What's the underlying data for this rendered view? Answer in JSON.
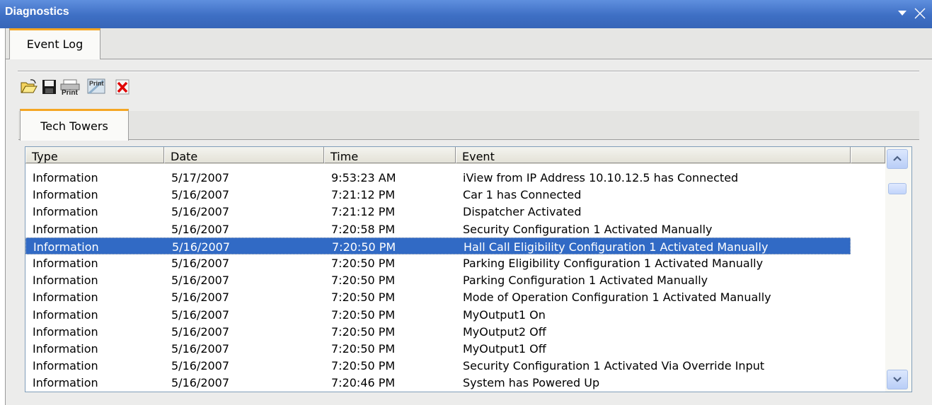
{
  "window": {
    "title": "Diagnostics",
    "dropdown_icon": "chevron-down-icon",
    "close_icon": "close-icon"
  },
  "outer_tabs": [
    {
      "label": "Event Log",
      "active": true
    }
  ],
  "toolbar": {
    "buttons": [
      {
        "name": "open-folder-button",
        "icon": "folder-open-icon"
      },
      {
        "name": "save-button",
        "icon": "save-icon"
      },
      {
        "name": "print-button",
        "icon": "print-icon",
        "label": "Print"
      },
      {
        "name": "print-preview-button",
        "icon": "print-preview-icon",
        "label": "Print"
      },
      {
        "name": "delete-button",
        "icon": "delete-icon"
      }
    ]
  },
  "inner_tabs": [
    {
      "label": "Tech Towers",
      "active": true
    }
  ],
  "grid": {
    "columns": [
      "Type",
      "Date",
      "Time",
      "Event"
    ],
    "rows": [
      {
        "type": "Information",
        "date": "5/17/2007",
        "time": "9:53:23 AM",
        "event": "iView from IP Address 10.10.12.5  has Connected"
      },
      {
        "type": "Information",
        "date": "5/16/2007",
        "time": "7:21:12 PM",
        "event": "Car 1 has Connected"
      },
      {
        "type": "Information",
        "date": "5/16/2007",
        "time": "7:21:12 PM",
        "event": "Dispatcher Activated"
      },
      {
        "type": "Information",
        "date": "5/16/2007",
        "time": "7:20:58 PM",
        "event": "Security Configuration 1 Activated Manually"
      },
      {
        "type": "Information",
        "date": "5/16/2007",
        "time": "7:20:50 PM",
        "event": "Hall Call Eligibility Configuration 1 Activated Manually",
        "selected": true
      },
      {
        "type": "Information",
        "date": "5/16/2007",
        "time": "7:20:50 PM",
        "event": "Parking Eligibility Configuration 1 Activated Manually"
      },
      {
        "type": "Information",
        "date": "5/16/2007",
        "time": "7:20:50 PM",
        "event": "Parking Configuration 1 Activated Manually"
      },
      {
        "type": "Information",
        "date": "5/16/2007",
        "time": "7:20:50 PM",
        "event": "Mode of Operation Configuration 1 Activated Manually"
      },
      {
        "type": "Information",
        "date": "5/16/2007",
        "time": "7:20:50 PM",
        "event": "MyOutput1 On"
      },
      {
        "type": "Information",
        "date": "5/16/2007",
        "time": "7:20:50 PM",
        "event": "MyOutput2 Off"
      },
      {
        "type": "Information",
        "date": "5/16/2007",
        "time": "7:20:50 PM",
        "event": "MyOutput1 Off"
      },
      {
        "type": "Information",
        "date": "5/16/2007",
        "time": "7:20:50 PM",
        "event": "Security Configuration 1 Activated Via Override Input"
      },
      {
        "type": "Information",
        "date": "5/16/2007",
        "time": "7:20:46 PM",
        "event": "System has Powered Up"
      }
    ],
    "scroll_up_icon": "chevron-up-icon",
    "scroll_down_icon": "chevron-down-icon"
  },
  "colors": {
    "titlebar": "#3e6fc4",
    "tab_accent": "#f5a623",
    "selection": "#316ac5"
  }
}
